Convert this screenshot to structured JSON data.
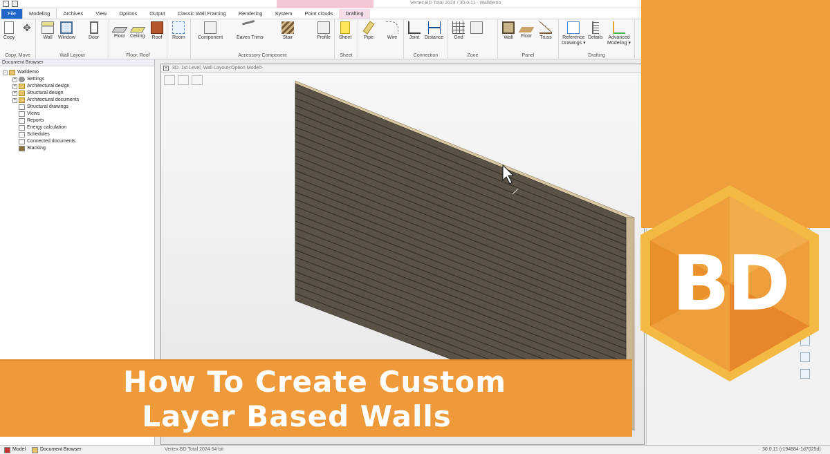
{
  "window": {
    "title": "Vertex BD Total 2024 / 30.0.11 - Walldemo"
  },
  "tabs": [
    "File",
    "Modeling",
    "Archives",
    "View",
    "Options",
    "Output",
    "Classic Wall Framing",
    "Rendering",
    "System",
    "Point clouds",
    "Drafting"
  ],
  "active_tab": "Modeling",
  "ribbon": {
    "groups": {
      "copy_move": "Copy, Move",
      "wall_layout": "Wall Layout",
      "floor_roof": "Floor, Roof",
      "accessory": "Accessory Component",
      "sheet": "Sheet",
      "connection": "Connection",
      "zone": "Zone",
      "panel": "Panel",
      "drafting": "Drafting"
    },
    "buttons": {
      "copy": "Copy",
      "wall": "Wall",
      "window": "Window",
      "door": "Door",
      "floor": "Floor",
      "ceiling": "Ceiling",
      "roof": "Roof",
      "room": "Room",
      "component": "Component",
      "eaves_trims": "Eaves Trims",
      "stair": "Stair",
      "profile": "Profile",
      "sheet": "Sheet",
      "pipe": "Pipe",
      "wire": "Wire",
      "joint": "Joint",
      "distance": "Distance",
      "grid": "Grid",
      "panel_wall": "Wall",
      "panel_floor": "Floor",
      "truss": "Truss",
      "reference_drawings_1": "Reference",
      "reference_drawings_2": "Drawings ▾",
      "details": "Details",
      "advanced_modeling_1": "Advanced",
      "advanced_modeling_2": "Modeling ▾"
    }
  },
  "doc_browser": {
    "title": "Document Browser",
    "root": "Walldemo",
    "items": [
      {
        "label": "Settings",
        "expandable": true,
        "icon": "gear"
      },
      {
        "label": "Architectural design",
        "expandable": true,
        "icon": "folder"
      },
      {
        "label": "Structural design",
        "expandable": true,
        "icon": "folder"
      },
      {
        "label": "Architectural documents",
        "expandable": true,
        "icon": "folder"
      },
      {
        "label": "Structural drawings",
        "expandable": false,
        "icon": "doc"
      },
      {
        "label": "Views",
        "expandable": false,
        "icon": "doc"
      },
      {
        "label": "Reports",
        "expandable": false,
        "icon": "doc"
      },
      {
        "label": "Energy calculation",
        "expandable": false,
        "icon": "doc"
      },
      {
        "label": "Schedules",
        "expandable": false,
        "icon": "doc"
      },
      {
        "label": "Connected documents",
        "expandable": false,
        "icon": "doc"
      },
      {
        "label": "Stacking",
        "expandable": false,
        "icon": "stack"
      }
    ]
  },
  "viewport": {
    "title": "3D: 1st Level, Wall Layout<Option Model>"
  },
  "statusbar": {
    "tab_model": "Model",
    "tab_doc_browser": "Document Browser",
    "product": "Vertex BD Total  2024  64-bit",
    "version": "30.0.11 (r194884-1d7025d)"
  },
  "branding": {
    "logo_text": "BD"
  },
  "banner": {
    "line1": "How To Create Custom",
    "line2": "Layer Based Walls"
  },
  "colors": {
    "accent_orange": "#ee9f3b",
    "wall_face": "#5a5246",
    "wall_top": "#d9c8a4",
    "file_tab": "#1f66c8"
  }
}
